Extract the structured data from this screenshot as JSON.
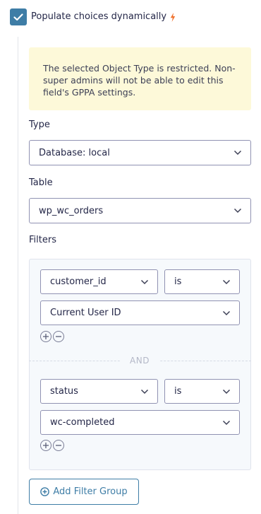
{
  "header": {
    "checkbox_checked": true,
    "label": "Populate choices dynamically",
    "bolt_color": "#f0722e",
    "accent": "#3e7da6"
  },
  "notice": {
    "text": "The selected Object Type is restricted. Non-super admins will not be able to edit this field's GPPA settings."
  },
  "type": {
    "label": "Type",
    "value": "Database: local"
  },
  "table": {
    "label": "Table",
    "value": "wp_wc_orders"
  },
  "filters": {
    "label": "Filters",
    "groups": [
      {
        "field": "customer_id",
        "operator": "is",
        "value": "Current User ID"
      },
      {
        "field": "status",
        "operator": "is",
        "value": "wc-completed"
      }
    ],
    "separator": "AND"
  },
  "add_filter_group": {
    "label": "Add Filter Group"
  }
}
